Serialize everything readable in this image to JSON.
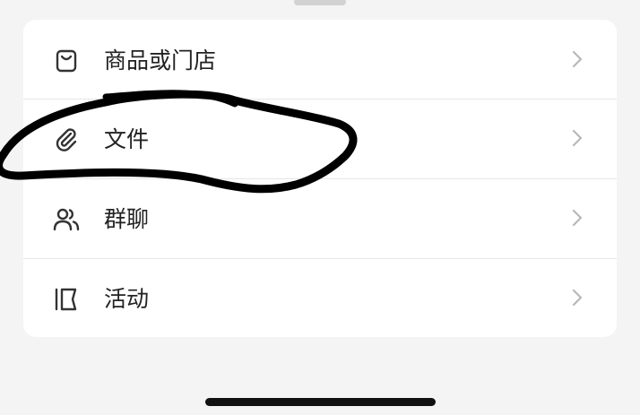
{
  "menu": {
    "items": [
      {
        "label": "商品或门店",
        "icon": "shopping-bag-icon"
      },
      {
        "label": "文件",
        "icon": "paperclip-icon"
      },
      {
        "label": "群聊",
        "icon": "group-users-icon"
      },
      {
        "label": "活动",
        "icon": "flag-icon"
      }
    ]
  },
  "colors": {
    "background": "#f4f4f4",
    "card": "#ffffff",
    "text": "#222222",
    "icon": "#333333",
    "chevron": "#b8b8b8",
    "ink": "#000000"
  }
}
